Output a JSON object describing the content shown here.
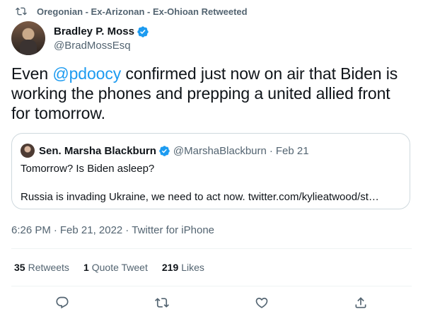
{
  "retweet_context": {
    "icon": "retweet-icon",
    "label": "Oregonian - Ex-Arizonan - Ex-Ohioan Retweeted"
  },
  "author": {
    "display_name": "Bradley P. Moss",
    "handle": "@BradMossEsq",
    "verified_icon": "verified-badge-icon"
  },
  "tweet": {
    "text_before": "Even ",
    "mention": "@pdoocy",
    "text_after": " confirmed just now on air that Biden is working the phones and prepping a united allied front for tomorrow."
  },
  "quote_tweet": {
    "display_name": "Sen. Marsha Blackburn",
    "handle": "@MarshaBlackburn",
    "separator": "·",
    "date": "Feb 21",
    "line1": "Tomorrow? Is Biden asleep?",
    "line2": "Russia is invading Ukraine, we need to act now. twitter.com/kylieatwood/st…"
  },
  "meta": {
    "time": "6:26 PM",
    "sep1": "·",
    "date": "Feb 21, 2022",
    "sep2": "·",
    "source": "Twitter for iPhone"
  },
  "stats": {
    "retweets_count": "35",
    "retweets_label": "Retweets",
    "quotes_count": "1",
    "quotes_label": "Quote Tweet",
    "likes_count": "219",
    "likes_label": "Likes"
  },
  "actions": {
    "reply_icon": "reply-icon",
    "retweet_icon": "retweet-icon",
    "like_icon": "heart-icon",
    "share_icon": "share-icon"
  },
  "colors": {
    "accent": "#1d9bf0",
    "text": "#0f1419",
    "secondary": "#536471",
    "border": "#cfd9de"
  }
}
